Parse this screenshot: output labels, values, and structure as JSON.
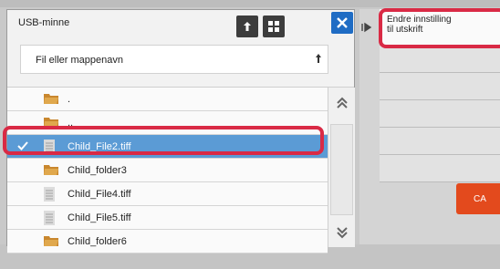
{
  "dialog": {
    "title": "USB-minne",
    "toolbar_icons": [
      "up-folder-icon",
      "thumbnail-view-icon",
      "close-icon"
    ]
  },
  "sort": {
    "label": "Fil eller mappenavn",
    "direction_icon": "sort-ascending-icon"
  },
  "files": [
    {
      "name": ".",
      "type": "folder",
      "selected": false
    },
    {
      "name": "..",
      "type": "folder",
      "selected": false
    },
    {
      "name": "Child_File2.tiff",
      "type": "file",
      "selected": true
    },
    {
      "name": "Child_folder3",
      "type": "folder",
      "selected": false
    },
    {
      "name": "Child_File4.tiff",
      "type": "file",
      "selected": false
    },
    {
      "name": "Child_File5.tiff",
      "type": "file",
      "selected": false
    },
    {
      "name": "Child_folder6",
      "type": "folder",
      "selected": false
    }
  ],
  "side_panel": {
    "setting_line1": "Endre innstilling",
    "setting_line2": "til utskrift",
    "ca_label": "CA"
  },
  "colors": {
    "accent_blue": "#1f6cc4",
    "selection": "#5b9bd5",
    "highlight_frame": "#d92a45",
    "ca_button": "#e34a1d"
  }
}
